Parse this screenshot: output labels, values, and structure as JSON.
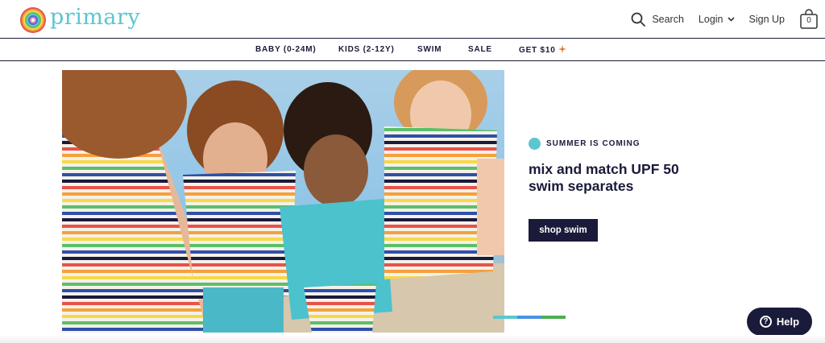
{
  "brand": {
    "name": "primary"
  },
  "header": {
    "search_label": "Search",
    "login_label": "Login",
    "signup_label": "Sign Up",
    "cart_count": "0"
  },
  "nav": {
    "items": [
      {
        "label": "BABY (0-24M)"
      },
      {
        "label": "KIDS (2-12Y)"
      },
      {
        "label": "SWIM"
      },
      {
        "label": "SALE"
      },
      {
        "label": "GET $10"
      }
    ]
  },
  "hero": {
    "eyebrow": "SUMMER IS COMING",
    "headline": "mix and match UPF 50 swim separates",
    "cta_label": "shop swim",
    "carousel": {
      "slides": 3,
      "active": 1
    }
  },
  "help": {
    "label": "Help"
  },
  "colors": {
    "navy": "#1a1a3a",
    "teal": "#5bc6d0",
    "blue": "#4a90e2",
    "green": "#4caf50"
  },
  "icons": [
    "rainbow-logo-icon",
    "search-icon",
    "chevron-down-icon",
    "shopping-bag-icon",
    "sparkle-icon",
    "help-icon"
  ]
}
